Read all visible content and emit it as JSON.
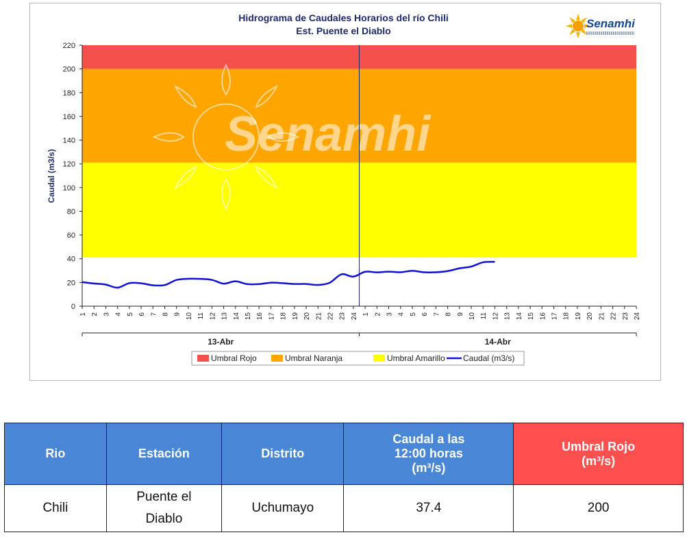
{
  "chart_data": {
    "type": "line",
    "title": "Hidrograma de Caudales Horarios del río Chili",
    "subtitle": "Est. Puente el Diablo",
    "ylabel": "Caudal  (m3/s)",
    "xlabel": "",
    "ylim": [
      0,
      220
    ],
    "yticks": [
      0,
      20,
      40,
      60,
      80,
      100,
      120,
      140,
      160,
      180,
      200,
      220
    ],
    "x_ticks": [
      "1",
      "2",
      "3",
      "4",
      "5",
      "6",
      "7",
      "8",
      "9",
      "10",
      "11",
      "12",
      "13",
      "14",
      "15",
      "16",
      "17",
      "18",
      "19",
      "20",
      "21",
      "22",
      "23",
      "24",
      "1",
      "2",
      "3",
      "4",
      "5",
      "6",
      "7",
      "8",
      "9",
      "10",
      "11",
      "12",
      "13",
      "14",
      "15",
      "16",
      "17",
      "18",
      "19",
      "20",
      "21",
      "22",
      "23",
      "24"
    ],
    "day_labels": [
      "13-Abr",
      "14-Abr"
    ],
    "thresholds": [
      {
        "name": "Umbral Rojo",
        "from": 200,
        "to": 220,
        "color": "#f4514d"
      },
      {
        "name": "Umbral Naranja",
        "from": 121,
        "to": 200,
        "color": "#ffa500"
      },
      {
        "name": "Umbral Amarillo",
        "from": 41,
        "to": 121,
        "color": "#ffff00"
      }
    ],
    "series": [
      {
        "name": "Caudal (m3/s)",
        "color": "#1010d6",
        "values": [
          20.3,
          19.1,
          18.2,
          15.6,
          19.4,
          19.3,
          17.6,
          17.8,
          22.1,
          23.1,
          23.0,
          22.2,
          19.0,
          21.0,
          18.6,
          18.6,
          19.8,
          19.4,
          18.7,
          18.7,
          17.9,
          19.8,
          26.9,
          24.9,
          29.0,
          28.5,
          29.1,
          28.6,
          29.8,
          28.6,
          28.6,
          29.6,
          31.9,
          33.4,
          37.0,
          37.4
        ]
      }
    ],
    "grid": false,
    "legend_position": "bottom"
  },
  "watermark": "Senamhi",
  "logo": {
    "text": "Senamhi",
    "icon": "sun-icon"
  },
  "table": {
    "headers": [
      "Rio",
      "Estación",
      "Distrito",
      "Caudal a las 12:00 horas (m³/s)",
      "Umbral Rojo (m³/s)"
    ],
    "rows": [
      [
        "Chili",
        "Puente el Diablo",
        "Uchumayo",
        "37.4",
        "200"
      ]
    ]
  }
}
